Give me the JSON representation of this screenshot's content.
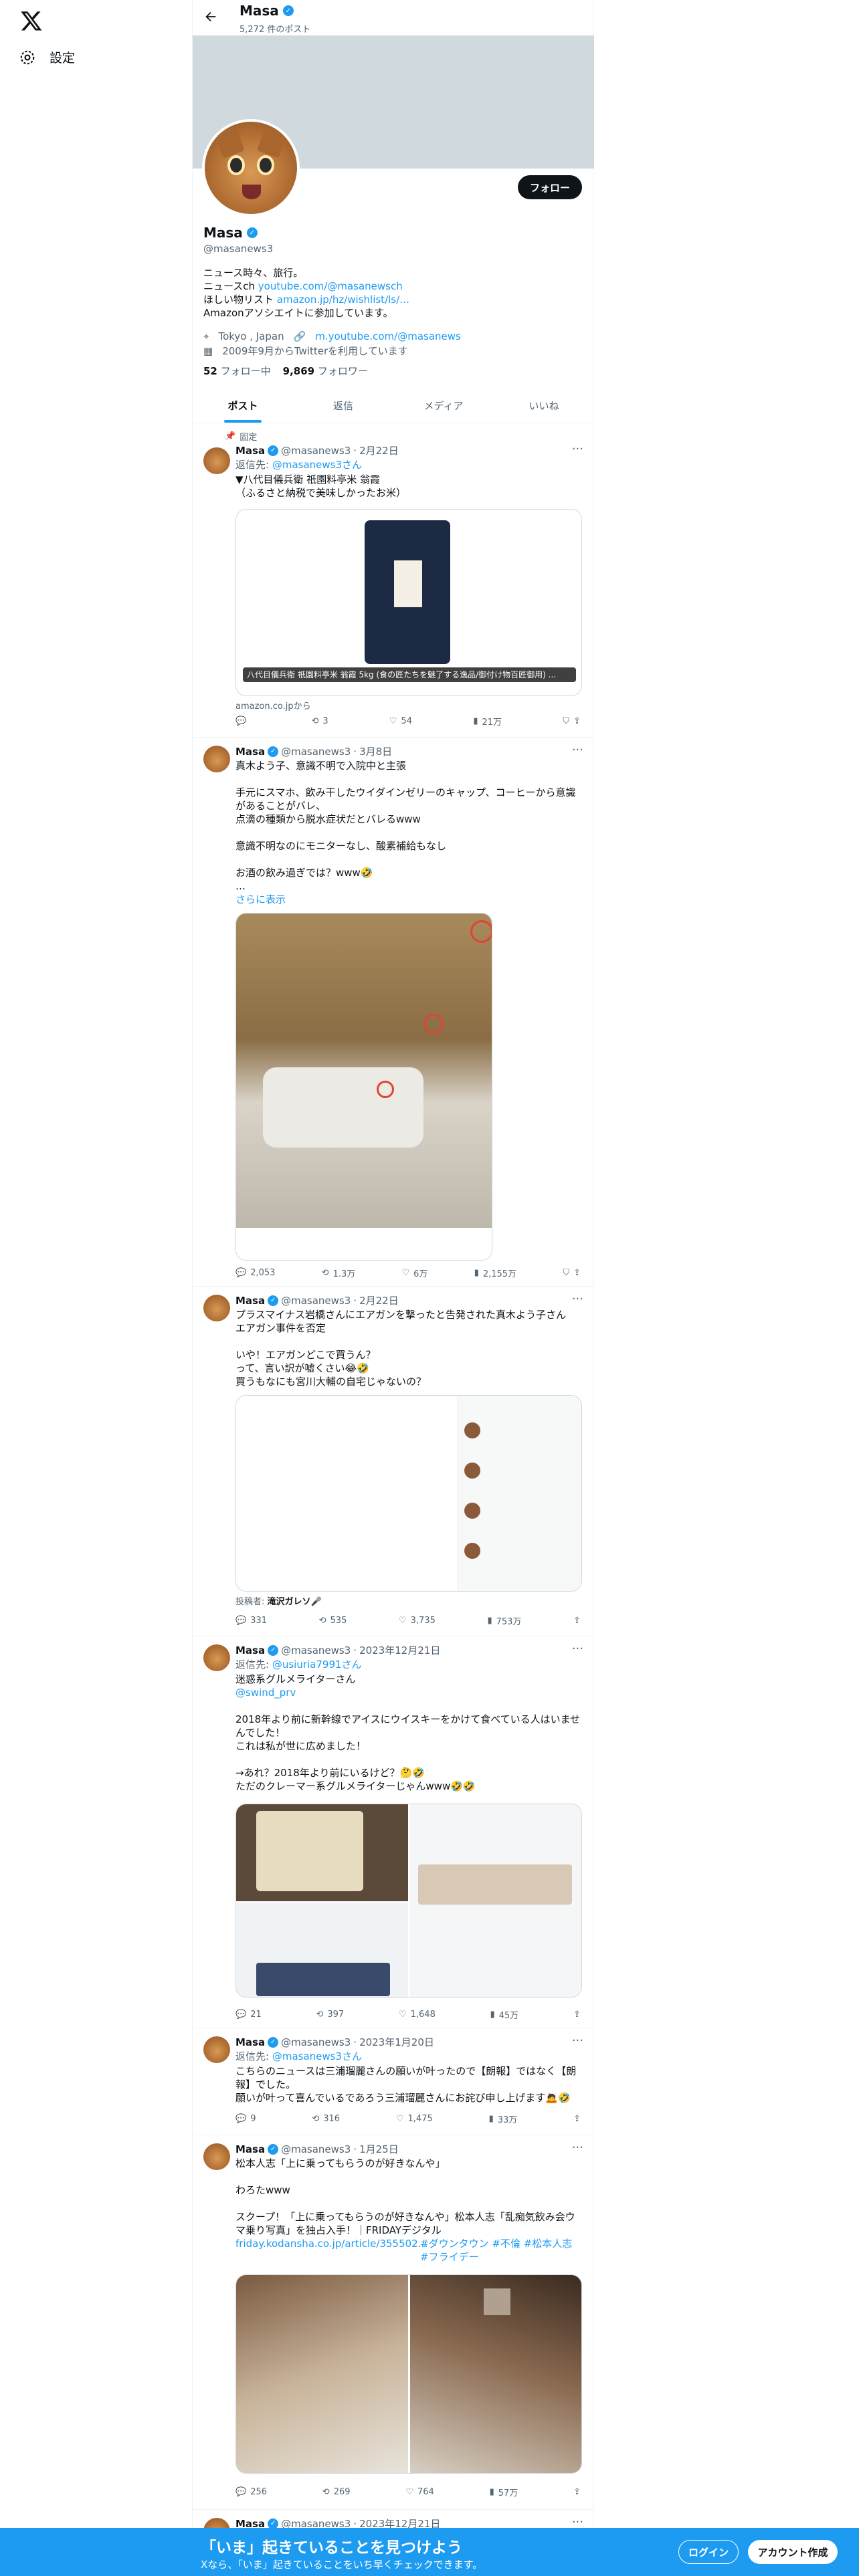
{
  "nav": {
    "settings_label": "設定"
  },
  "profile": {
    "top_name": "Masa",
    "post_count": "5,272 件のポスト",
    "name": "Masa",
    "handle": "@masanews3",
    "follow_label": "フォロー",
    "bio_line1": "ニュース時々、旅行。",
    "bio_line2_prefix": "ニュースch ",
    "bio_line2_link": "youtube.com/@masanewsch",
    "bio_line3_prefix": "ほしい物リスト ",
    "bio_line3_link": "amazon.jp/hz/wishlist/ls/…",
    "bio_line4": "Amazonアソシエイトに参加しています。",
    "location": "Tokyo , Japan",
    "website": "m.youtube.com/@masanews",
    "joined": "2009年9月からTwitterを利用しています",
    "following_count": "52",
    "following_label": "フォロー中",
    "followers_count": "9,869",
    "followers_label": "フォロワー"
  },
  "tabs": [
    "ポスト",
    "返信",
    "メディア",
    "いいね"
  ],
  "pinned_label": "固定",
  "tweets": [
    {
      "name": "Masa",
      "handle": "@masanews3",
      "date": "2月22日",
      "reply_prefix": "返信先: ",
      "reply_to": "@masanews3さん",
      "text": "▼八代目儀兵衛 祇園料亭米 翁霞\n（ふるさと納税で美味しかったお米）",
      "card_caption": "八代目儀兵衛 祇園料亭米 翁霞 5kg (食の匠たちを魅了する逸品/御付け物百匠御用) ...",
      "card_domain": "amazon.co.jpから",
      "stats": {
        "replies": "",
        "retweets": "3",
        "likes": "54",
        "views": "21万"
      }
    },
    {
      "name": "Masa",
      "handle": "@masanews3",
      "date": "3月8日",
      "text": "真木よう子、意識不明で入院中と主張\n\n手元にスマホ、飲み干したウイダインゼリーのキャップ、コーヒーから意識があることがバレ、\n点滴の種類から脱水症状だとバレるwww\n\n意識不明なのにモニターなし、酸素補給もなし\n\nお酒の飲み過ぎでは？www🤣\n…",
      "show_more": "さらに表示",
      "stats": {
        "replies": "2,053",
        "retweets": "1.3万",
        "likes": "6万",
        "views": "2,155万"
      }
    },
    {
      "name": "Masa",
      "handle": "@masanews3",
      "date": "2月22日",
      "text": "プラスマイナス岩橋さんにエアガンを撃ったと告発された真木よう子さん\nエアガン事件を否定\n\nいや！エアガンどこで買うん？\nって、言い訳が嘘くさい😂🤣\n買うもなにも宮川大輔の自宅じゃないの？",
      "poster_label": "投稿者: ",
      "poster_name": "滝沢ガレソ🎤",
      "stats": {
        "replies": "331",
        "retweets": "535",
        "likes": "3,735",
        "views": "753万"
      }
    },
    {
      "name": "Masa",
      "handle": "@masanews3",
      "date": "2023年12月21日",
      "reply_prefix": "返信先: ",
      "reply_to": "@usiuria7991さん",
      "text": "迷惑系グルメライターさん",
      "text_link": "@swind_prv",
      "text2": "2018年より前に新幹線でアイスにウイスキーをかけて食べている人はいませんでした！\nこれは私が世に広めました！\n\n→あれ？2018年より前にいるけど？🤔🤣\nただのクレーマー系グルメライターじゃんwww🤣🤣",
      "stats": {
        "replies": "21",
        "retweets": "397",
        "likes": "1,648",
        "views": "45万"
      }
    },
    {
      "name": "Masa",
      "handle": "@masanews3",
      "date": "2023年1月20日",
      "reply_prefix": "返信先: ",
      "reply_to": "@masanews3さん",
      "text": "こちらのニュースは三浦瑠麗さんの願いが叶ったので【朗報】ではなく【朗報】でした。\n願いが叶って喜んでいるであろう三浦瑠麗さんにお詫び申し上げます🙇🤣",
      "stats": {
        "replies": "9",
        "retweets": "316",
        "likes": "1,475",
        "views": "33万"
      }
    },
    {
      "name": "Masa",
      "handle": "@masanews3",
      "date": "1月25日",
      "text": "松本人志「上に乗ってもらうのが好きなんや」\n\nわろたwww\n\nスクープ！「上に乗ってもらうのが好きなんや」松本人志「乱痴気飲み会ウマ乗り写真」を独占入手！｜FRIDAYデジタル",
      "link_text": "friday.kodansha.co.jp/article/355502…",
      "hashtags": "#ダウンタウン #不倫 #松本人志 #フライデー",
      "stats": {
        "replies": "256",
        "retweets": "269",
        "likes": "764",
        "views": "57万"
      }
    },
    {
      "name": "Masa",
      "handle": "@masanews3",
      "date": "2023年12月21日"
    }
  ],
  "bottom_bar": {
    "title": "「いま」起きていることを見つけよう",
    "subtitle": "Xなら、「いま」起きていることをいち早くチェックできます。",
    "login": "ログイン",
    "signup": "アカウント作成"
  },
  "colors": {
    "accent": "#1d9bf0",
    "text": "#0f1419",
    "muted": "#536471",
    "border": "#eff3f4"
  }
}
